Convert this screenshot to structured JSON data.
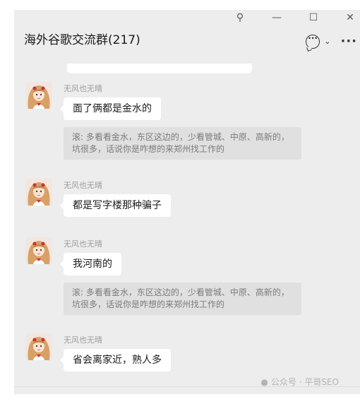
{
  "window": {
    "controls": {
      "pin": "⚲",
      "minimize": "—",
      "maximize": "☐",
      "close": "✕"
    },
    "title": "海外谷歌交流群(217)",
    "actions": {
      "chat_icon": "chat-bubble-icon",
      "dropdown": "⌄",
      "more": "···"
    }
  },
  "messages": [
    {
      "sender": "无风也无晴",
      "text": "面了俩都是金水的",
      "quote": "滚: 多看看金水，东区这边的，少看管城、中原、高新的，坑很多，话说你是咋想的来郑州找工作的"
    },
    {
      "sender": "无风也无晴",
      "text": "都是写字楼那种骗子"
    },
    {
      "sender": "无风也无晴",
      "text": "我河南的",
      "quote": "滚: 多看看金水，东区这边的，少看管城、中原、高新的，坑很多，话说你是咋想的来郑州找工作的"
    },
    {
      "sender": "无风也无晴",
      "text": "省会离家近，熟人多"
    }
  ],
  "watermark": {
    "icon": "wechat-icon",
    "text": "公众号 · 平哥SEO"
  },
  "colors": {
    "window_bg": "#ededed",
    "bubble_bg": "#ffffff",
    "quote_bg": "#e0e0e0",
    "sender": "#9c9c9c"
  }
}
